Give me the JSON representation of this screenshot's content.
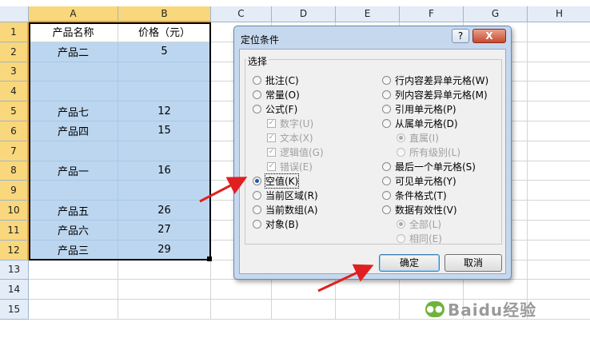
{
  "sheet": {
    "columns": [
      "A",
      "B",
      "C",
      "D",
      "E",
      "F",
      "G",
      "H"
    ],
    "rows": [
      "1",
      "2",
      "3",
      "4",
      "5",
      "6",
      "7",
      "8",
      "9",
      "10",
      "11",
      "12",
      "13",
      "14",
      "15"
    ],
    "cells": {
      "A1": "产品名称",
      "B1": "价格（元）",
      "A2": "产品二",
      "B2": "5",
      "A5": "产品七",
      "B5": "12",
      "A6": "产品四",
      "B6": "15",
      "A8": "产品一",
      "B8": "16",
      "A10": "产品五",
      "B10": "26",
      "A11": "产品六",
      "B11": "27",
      "A12": "产品三",
      "B12": "29"
    }
  },
  "dialog": {
    "title": "定位条件",
    "help": "?",
    "close": "X",
    "group_label": "选择",
    "left_options": [
      "批注(C)",
      "常量(O)",
      "公式(F)"
    ],
    "formula_checks": [
      "数字(U)",
      "文本(X)",
      "逻辑值(G)",
      "错误(E)"
    ],
    "left_options2": [
      "空值(K)",
      "当前区域(R)",
      "当前数组(A)",
      "对象(B)"
    ],
    "right_options": [
      "行内容差异单元格(W)",
      "列内容差异单元格(M)",
      "引用单元格(P)",
      "从属单元格(D)"
    ],
    "dependents_sub": [
      "直属(I)",
      "所有级别(L)"
    ],
    "right_options2": [
      "最后一个单元格(S)",
      "可见单元格(Y)",
      "条件格式(T)",
      "数据有效性(V)"
    ],
    "validation_sub": [
      "全部(L)",
      "相同(E)"
    ],
    "ok": "确定",
    "cancel": "取消",
    "selected": "空值(K)"
  },
  "watermark": "Baidu经验"
}
